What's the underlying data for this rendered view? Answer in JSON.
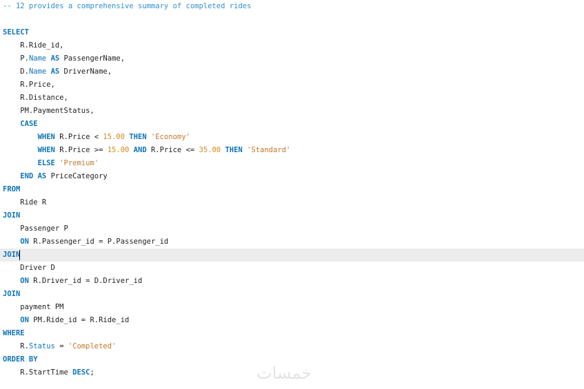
{
  "editor": {
    "current_line_index": 19,
    "lines": [
      [
        {
          "t": "com",
          "v": "-- 12 provides a comprehensive summary of completed rides"
        }
      ],
      [],
      [
        {
          "t": "kw",
          "v": "SELECT"
        }
      ],
      [
        {
          "t": "id",
          "v": "    R.Ride_id,"
        }
      ],
      [
        {
          "t": "id",
          "v": "    P."
        },
        {
          "t": "col",
          "v": "Name"
        },
        {
          "t": "id",
          "v": " "
        },
        {
          "t": "kw",
          "v": "AS"
        },
        {
          "t": "id",
          "v": " PassengerName,"
        }
      ],
      [
        {
          "t": "id",
          "v": "    D."
        },
        {
          "t": "col",
          "v": "Name"
        },
        {
          "t": "id",
          "v": " "
        },
        {
          "t": "kw",
          "v": "AS"
        },
        {
          "t": "id",
          "v": " DriverName,"
        }
      ],
      [
        {
          "t": "id",
          "v": "    R.Price,"
        }
      ],
      [
        {
          "t": "id",
          "v": "    R.Distance,"
        }
      ],
      [
        {
          "t": "id",
          "v": "    PM.PaymentStatus,"
        }
      ],
      [
        {
          "t": "id",
          "v": "    "
        },
        {
          "t": "kw",
          "v": "CASE"
        }
      ],
      [
        {
          "t": "id",
          "v": "        "
        },
        {
          "t": "kw",
          "v": "WHEN"
        },
        {
          "t": "id",
          "v": " R.Price < "
        },
        {
          "t": "num",
          "v": "15.00"
        },
        {
          "t": "id",
          "v": " "
        },
        {
          "t": "kw",
          "v": "THEN"
        },
        {
          "t": "id",
          "v": " "
        },
        {
          "t": "str",
          "v": "'Economy'"
        }
      ],
      [
        {
          "t": "id",
          "v": "        "
        },
        {
          "t": "kw",
          "v": "WHEN"
        },
        {
          "t": "id",
          "v": " R.Price >= "
        },
        {
          "t": "num",
          "v": "15.00"
        },
        {
          "t": "id",
          "v": " "
        },
        {
          "t": "kw",
          "v": "AND"
        },
        {
          "t": "id",
          "v": " R.Price <= "
        },
        {
          "t": "num",
          "v": "35.00"
        },
        {
          "t": "id",
          "v": " "
        },
        {
          "t": "kw",
          "v": "THEN"
        },
        {
          "t": "id",
          "v": " "
        },
        {
          "t": "str",
          "v": "'Standard'"
        }
      ],
      [
        {
          "t": "id",
          "v": "        "
        },
        {
          "t": "kw",
          "v": "ELSE"
        },
        {
          "t": "id",
          "v": " "
        },
        {
          "t": "str",
          "v": "'Premium'"
        }
      ],
      [
        {
          "t": "id",
          "v": "    "
        },
        {
          "t": "kw",
          "v": "END"
        },
        {
          "t": "id",
          "v": " "
        },
        {
          "t": "kw",
          "v": "AS"
        },
        {
          "t": "id",
          "v": " PriceCategory"
        }
      ],
      [
        {
          "t": "kw",
          "v": "FROM"
        }
      ],
      [
        {
          "t": "id",
          "v": "    Ride R"
        }
      ],
      [
        {
          "t": "kw",
          "v": "JOIN"
        }
      ],
      [
        {
          "t": "id",
          "v": "    Passenger P"
        }
      ],
      [
        {
          "t": "id",
          "v": "    "
        },
        {
          "t": "kw",
          "v": "ON"
        },
        {
          "t": "id",
          "v": " R.Passenger_id = P.Passenger_id"
        }
      ],
      [
        {
          "t": "kw",
          "v": "JOIN"
        }
      ],
      [
        {
          "t": "id",
          "v": "    Driver D"
        }
      ],
      [
        {
          "t": "id",
          "v": "    "
        },
        {
          "t": "kw",
          "v": "ON"
        },
        {
          "t": "id",
          "v": " R.Driver_id = D.Driver_id"
        }
      ],
      [
        {
          "t": "kw",
          "v": "JOIN"
        }
      ],
      [
        {
          "t": "id",
          "v": "    payment PM"
        }
      ],
      [
        {
          "t": "id",
          "v": "    "
        },
        {
          "t": "kw",
          "v": "ON"
        },
        {
          "t": "id",
          "v": " PM.Ride_id = R.Ride_id"
        }
      ],
      [
        {
          "t": "kw",
          "v": "WHERE"
        }
      ],
      [
        {
          "t": "id",
          "v": "    R."
        },
        {
          "t": "col",
          "v": "Status"
        },
        {
          "t": "id",
          "v": " = "
        },
        {
          "t": "str",
          "v": "'Completed'"
        }
      ],
      [
        {
          "t": "kw",
          "v": "ORDER BY"
        }
      ],
      [
        {
          "t": "id",
          "v": "    R.StartTime "
        },
        {
          "t": "kw",
          "v": "DESC"
        },
        {
          "t": "id",
          "v": ";"
        }
      ]
    ]
  },
  "watermark": {
    "text": "خمسات"
  },
  "colors": {
    "keyword": "#0e74b8",
    "comment": "#2e8fd1",
    "number": "#d18a1d",
    "string": "#c7762a",
    "text": "#1e1e1e",
    "current_line": "#ececec"
  }
}
